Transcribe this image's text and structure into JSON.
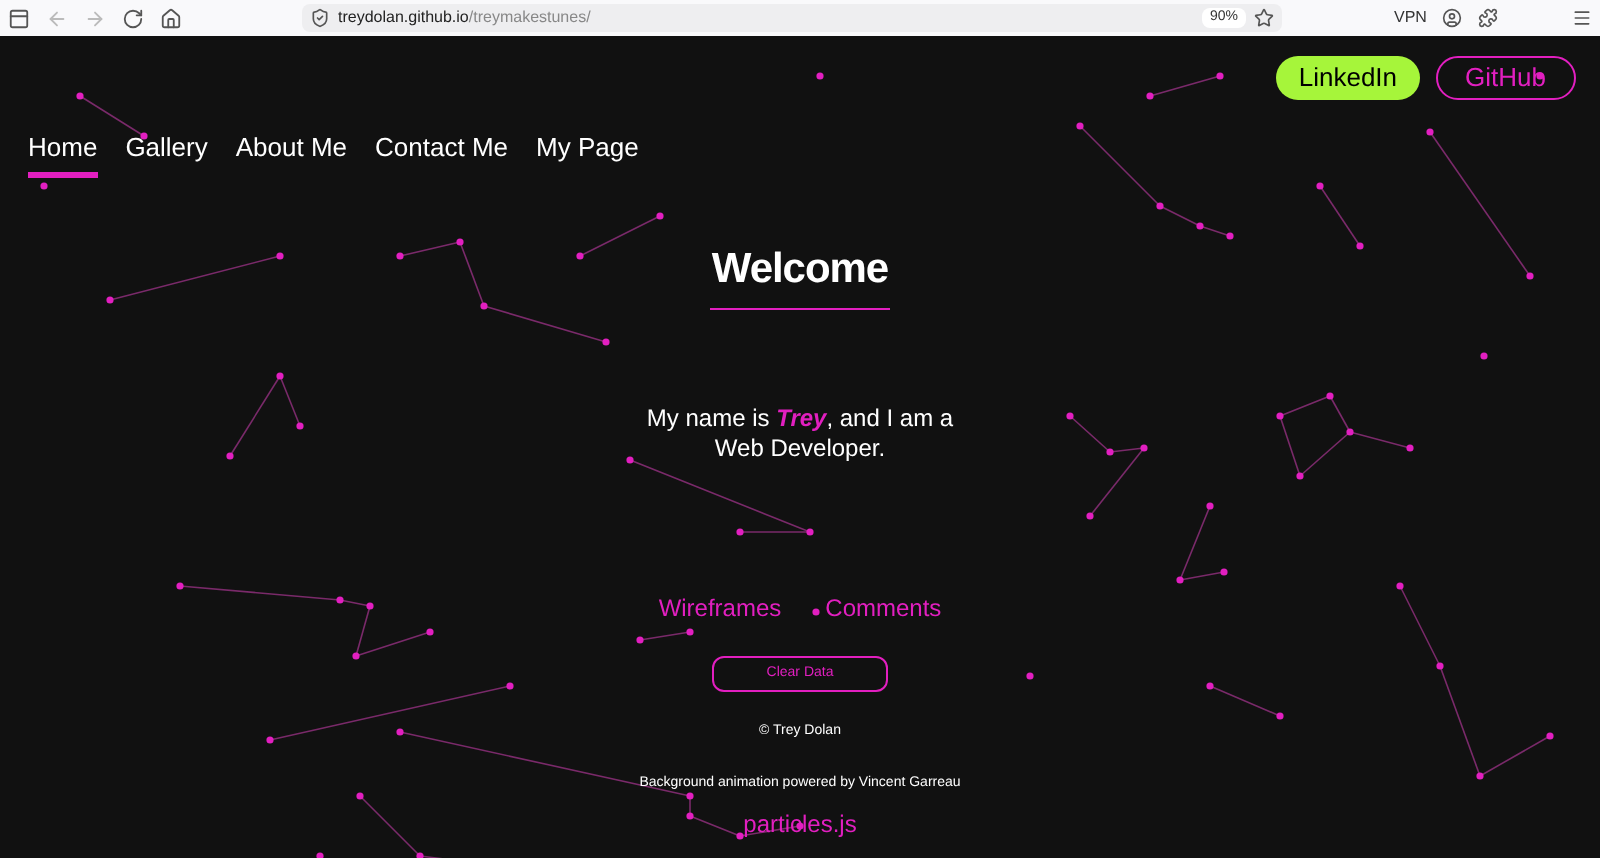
{
  "browser": {
    "url_domain": "treydolan.github.io",
    "url_path": "/treymakestunes/",
    "zoom": "90%",
    "vpn": "VPN"
  },
  "social_links": [
    {
      "label": "LinkedIn",
      "kind": "filled"
    },
    {
      "label": "GitHub",
      "kind": "outline"
    }
  ],
  "nav": [
    {
      "label": "Home",
      "selected": true
    },
    {
      "label": "Gallery",
      "selected": false
    },
    {
      "label": "About Me",
      "selected": false
    },
    {
      "label": "Contact Me",
      "selected": false
    },
    {
      "label": "My Page",
      "selected": false
    }
  ],
  "heading": "Welcome",
  "intro": "My name is **Trey**, and I am a Web Developer.",
  "links": [
    "Wireframes",
    "Comments"
  ],
  "clear_button": "Clear Data",
  "copyright": "© Trey Dolan",
  "credit": "Background animation powered by Vincent Garreau",
  "credit_link": "particles.js"
}
